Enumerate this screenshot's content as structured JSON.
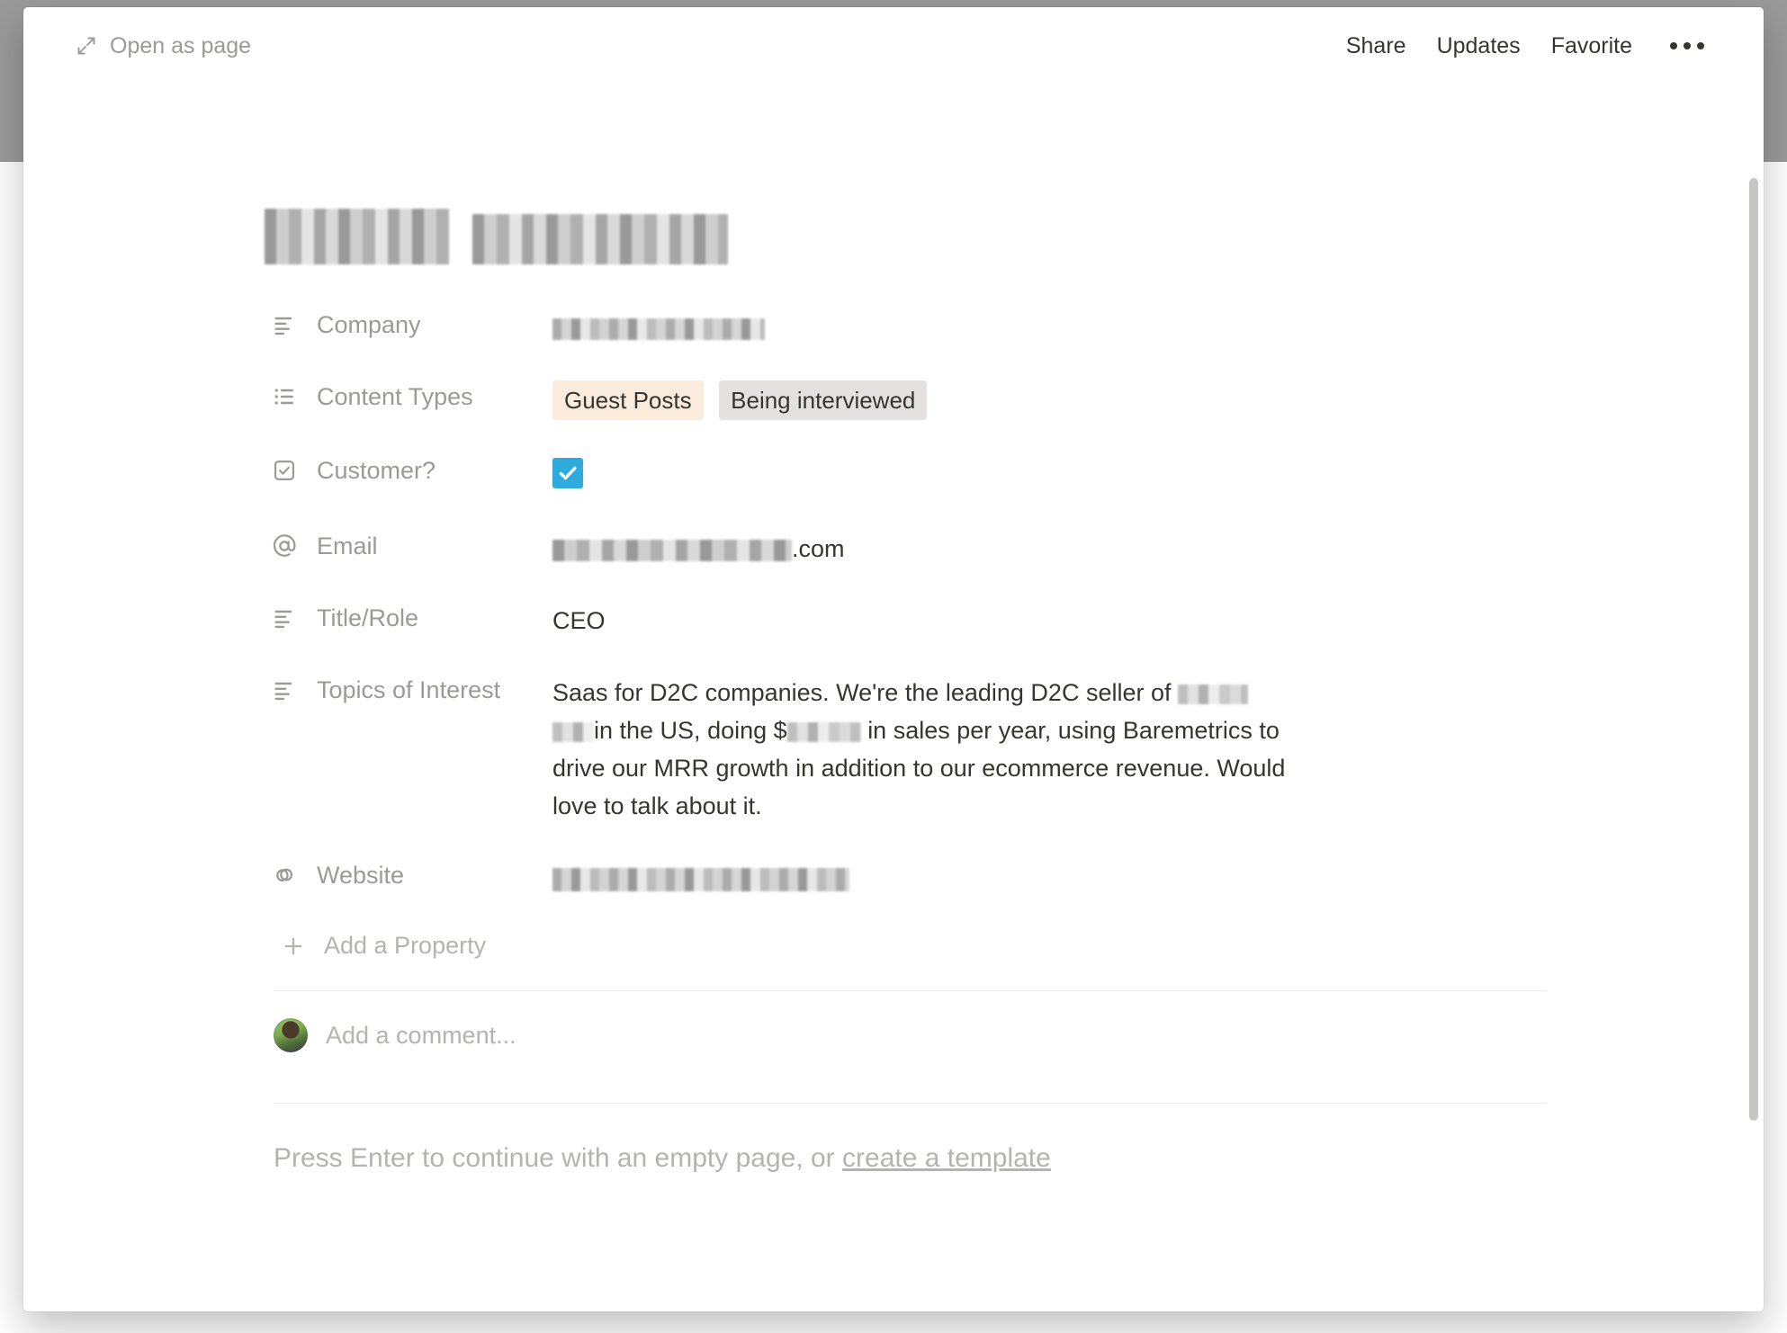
{
  "window": {
    "app": "Notion",
    "view": "page-peek-modal"
  },
  "topbar": {
    "open_as_page": "Open as page",
    "open_as_page_icon": "expand-arrows-icon",
    "actions": [
      {
        "label": "Share",
        "name": "share-button"
      },
      {
        "label": "Updates",
        "name": "updates-button"
      },
      {
        "label": "Favorite",
        "name": "favorite-button"
      }
    ],
    "more_icon": "ellipsis-icon"
  },
  "page": {
    "title_redacted": true,
    "title_parts": [
      "redacted-first-name",
      "redacted-last-name"
    ]
  },
  "properties": [
    {
      "name": "company",
      "label": "Company",
      "icon": "text-lines-icon",
      "type": "text",
      "value": "",
      "redacted": true,
      "redact_width": 190
    },
    {
      "name": "content-types",
      "label": "Content Types",
      "icon": "bulleted-list-icon",
      "type": "multi-select",
      "tags": [
        {
          "label": "Guest Posts",
          "color": "#faebdd"
        },
        {
          "label": "Being interviewed",
          "color": "#e3e2e0"
        }
      ]
    },
    {
      "name": "customer",
      "label": "Customer?",
      "icon": "checkbox-icon",
      "type": "checkbox",
      "checked": true,
      "accent": "#2eaadc"
    },
    {
      "name": "email",
      "label": "Email",
      "icon": "at-sign-icon",
      "type": "email",
      "value_suffix": ".com",
      "redacted": true,
      "redact_width": 214
    },
    {
      "name": "title-role",
      "label": "Title/Role",
      "icon": "text-lines-icon",
      "type": "text",
      "value": "CEO"
    },
    {
      "name": "topics-of-interest",
      "label": "Topics of Interest",
      "icon": "text-lines-icon",
      "type": "text",
      "text_line_1_a": "Saas for D2C companies.  We're the leading D2C seller of",
      "text_line_1_b": "in the US,",
      "text_line_2_a": "doing $",
      "text_line_2_b": "in sales per year, using Baremetrics to drive our MRR growth in addition",
      "text_line_3": "to our ecommerce revenue.  Would love to talk about it."
    },
    {
      "name": "website",
      "label": "Website",
      "icon": "link-swirl-icon",
      "type": "url",
      "value": "",
      "redacted": true,
      "redact_width": 262
    }
  ],
  "add_property": {
    "label": "Add a Property",
    "icon": "plus-icon"
  },
  "comment": {
    "placeholder": "Add a comment...",
    "avatar": "user-avatar"
  },
  "empty_hint": {
    "text": "Press Enter to continue with an empty page, or ",
    "link": "create a template"
  },
  "colors": {
    "accent_checkbox": "#2eaadc",
    "tag_yellow": "#faebdd",
    "tag_gray": "#e3e2e0",
    "text_primary": "#37352f",
    "text_muted": "#9b9a97",
    "text_placeholder": "#b4b3b0",
    "backdrop": "#8c8c8c"
  }
}
